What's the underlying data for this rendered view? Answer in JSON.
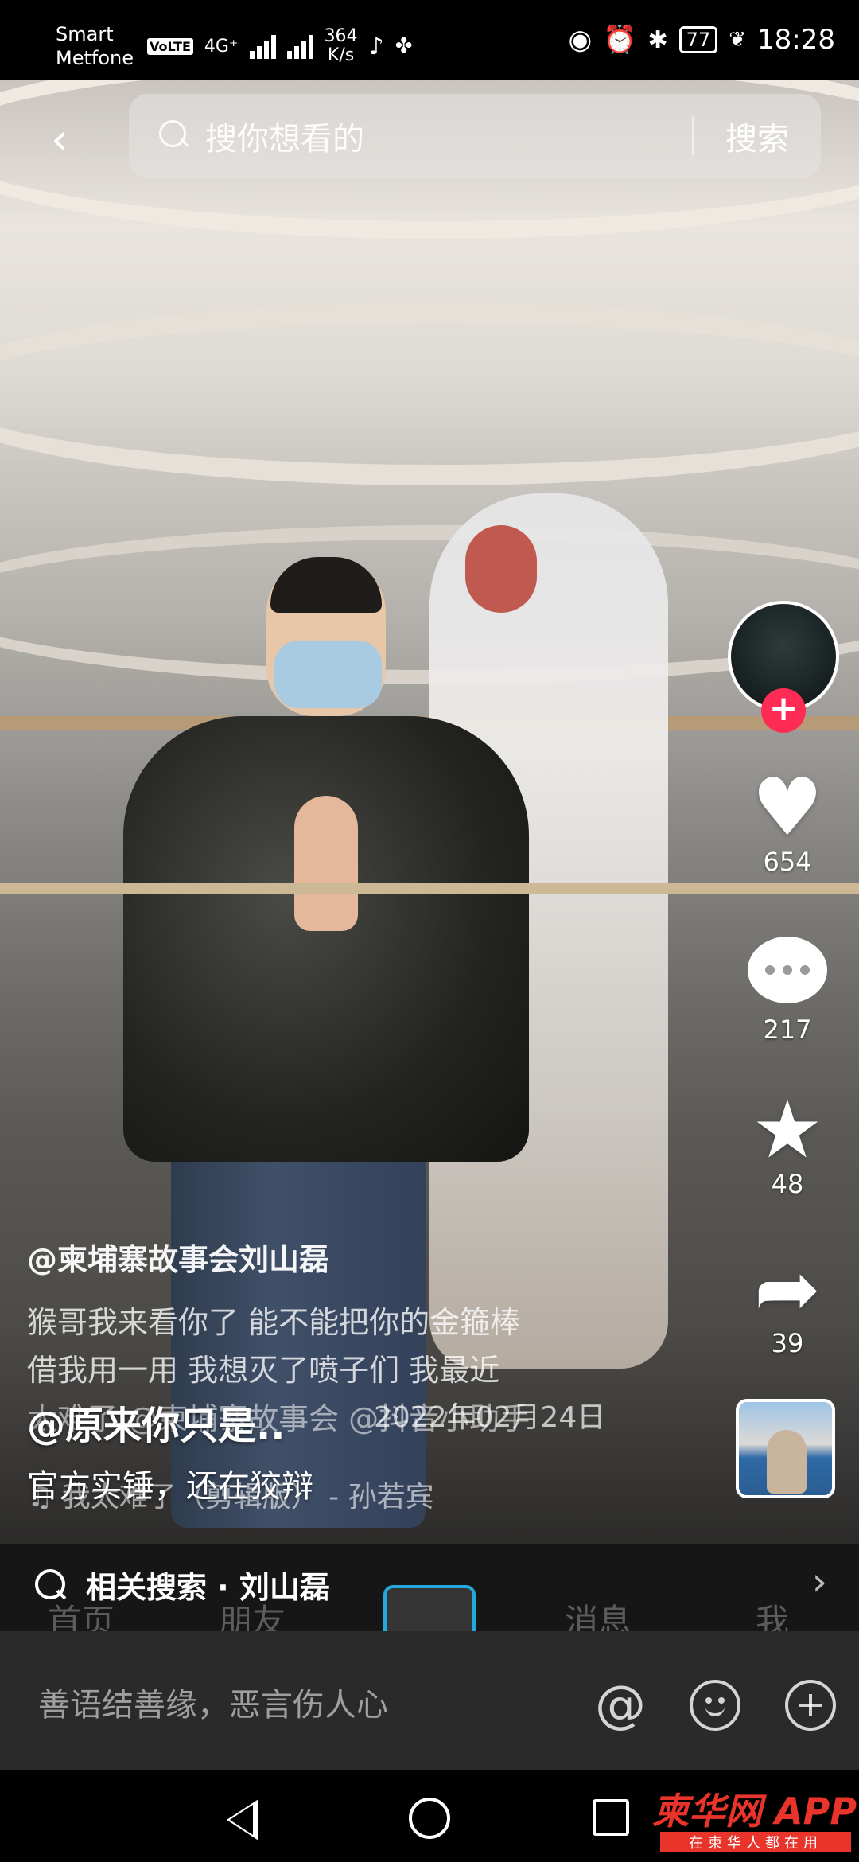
{
  "status_bar": {
    "carrier_top": "Smart",
    "carrier_bottom": "Metfone",
    "net_tag": "VoLTE",
    "net_type": "4G⁺",
    "speed_value": "364",
    "speed_unit": "K/s",
    "battery": "77",
    "time": "18:28"
  },
  "top_search": {
    "placeholder": "搜你想看的",
    "button": "搜索"
  },
  "actions": {
    "likes": "654",
    "comments": "217",
    "favorites": "48",
    "shares": "39"
  },
  "caption": {
    "author": "@柬埔寨故事会刘山磊",
    "desc_line1": "猴哥我来看你了 能不能把你的金箍棒",
    "desc_line2": "借我用一用 我想灭了喷子们 我最近",
    "desc_tail": "太难了 @柬埔寨故事会 @抖音小助手",
    "date": "2022年02月24日",
    "music": "♫ 我太难了（剪辑版） - 孙若宾"
  },
  "top_comment": {
    "user": "@原来你只是..",
    "text": "官方实锤，还在狡辩"
  },
  "related_search": {
    "label": "相关搜索 · 刘山磊"
  },
  "ghost_nav": {
    "home": "首页",
    "friends": "朋友",
    "messages": "消息",
    "me": "我"
  },
  "comment_input": {
    "placeholder": "善语结善缘，恶言伤人心"
  },
  "watermark": {
    "main": "柬华网 APP",
    "sub": "在柬华人都在用"
  },
  "colors": {
    "accent": "#fe2c55",
    "input_bar": "#2a2a2a",
    "related_bar": "#161616",
    "watermark": "#e8342b"
  }
}
